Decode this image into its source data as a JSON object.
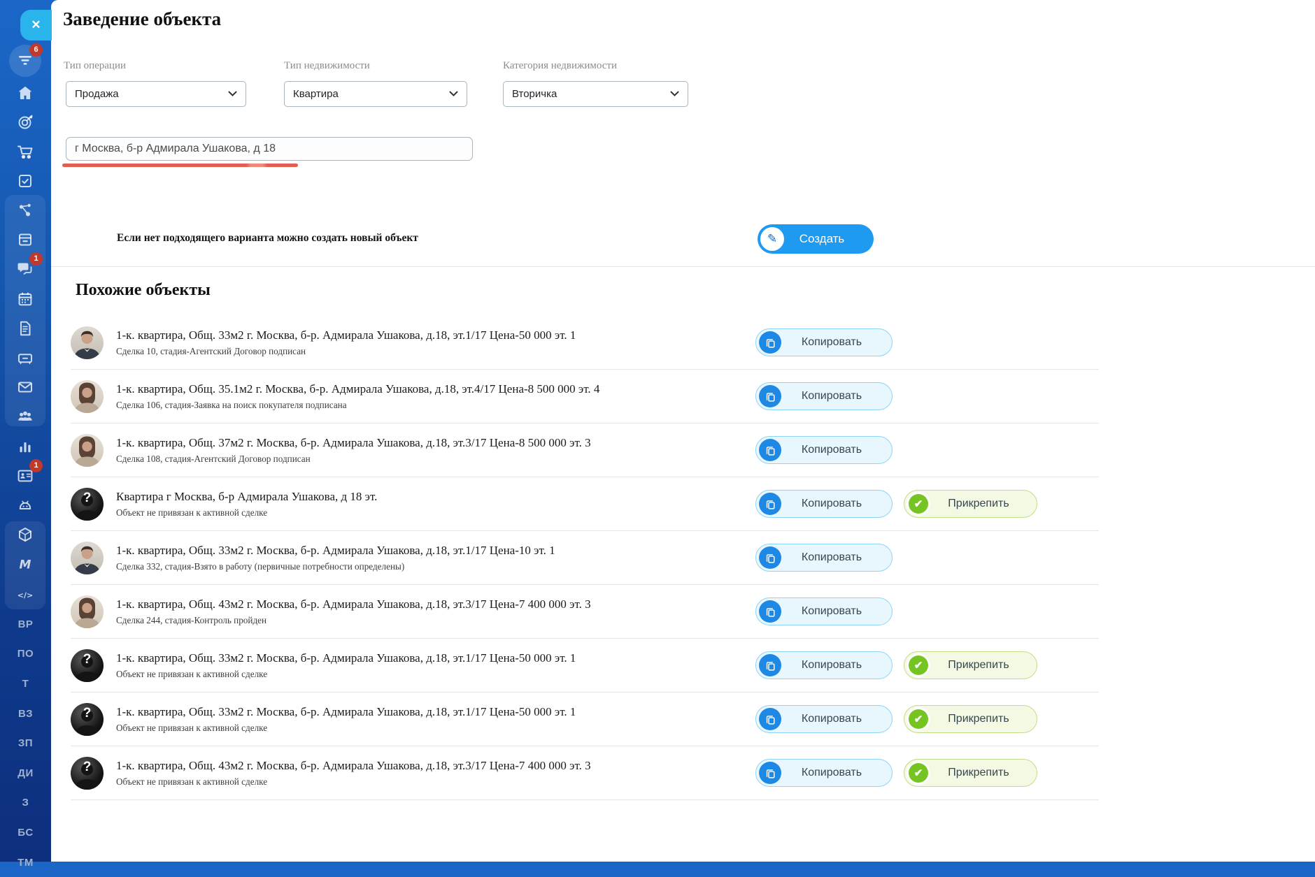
{
  "window": {
    "title": "Заведение объекта"
  },
  "sidebar": {
    "items": [
      {
        "icon": "filter-icon",
        "badge": "6"
      },
      {
        "icon": "home-icon"
      },
      {
        "icon": "target-icon"
      },
      {
        "icon": "cart-icon"
      },
      {
        "icon": "tasks-icon"
      },
      {
        "icon": "share-icon"
      },
      {
        "icon": "server-icon"
      },
      {
        "icon": "chat-icon",
        "badge": "1"
      },
      {
        "icon": "calendar-icon"
      },
      {
        "icon": "document-icon"
      },
      {
        "icon": "cash-drawer-icon"
      },
      {
        "icon": "mail-icon"
      },
      {
        "icon": "users-icon"
      },
      {
        "icon": "chart-icon"
      },
      {
        "icon": "contact-card-icon",
        "badge": "1"
      },
      {
        "icon": "robot-icon"
      },
      {
        "icon": "cube-icon"
      },
      {
        "icon": "logo-m-icon"
      },
      {
        "icon": "code-icon"
      }
    ],
    "text_items": [
      "ВР",
      "ПО",
      "Т",
      "ВЗ",
      "ЗП",
      "ДИ",
      "З",
      "БС",
      "ТМ"
    ]
  },
  "form": {
    "fields": [
      {
        "label": "Тип операции",
        "value": "Продажа"
      },
      {
        "label": "Тип недвижимости",
        "value": "Квартира"
      },
      {
        "label": "Категория недвижимости",
        "value": "Вторичка"
      }
    ],
    "address_value": "г Москва, б-р Адмирала Ушакова, д 18"
  },
  "create_section": {
    "hint": "Если нет подходящего варианта можно создать новый объект",
    "button_label": "Создать"
  },
  "similar": {
    "title": "Похожие объекты",
    "copy_label": "Копировать",
    "attach_label": "Прикрепить",
    "items": [
      {
        "avatar": "male-photo",
        "title": "1-к. квартира, Общ. 33м2 г. Москва, б-р. Адмирала Ушакова, д.18, эт.1/17 Цена-50 000 эт. 1",
        "subtitle": "Сделка 10, стадия-Агентский Договор подписан",
        "can_attach": false
      },
      {
        "avatar": "female-photo",
        "title": "1-к. квартира, Общ. 35.1м2 г. Москва, б-р. Адмирала Ушакова, д.18, эт.4/17 Цена-8 500 000 эт. 4",
        "subtitle": "Сделка 106, стадия-Заявка на поиск покупателя подписана",
        "can_attach": false
      },
      {
        "avatar": "female-photo",
        "title": "1-к. квартира, Общ. 37м2 г. Москва, б-р. Адмирала Ушакова, д.18, эт.3/17 Цена-8 500 000 эт. 3",
        "subtitle": "Сделка 108, стадия-Агентский Договор подписан",
        "can_attach": false
      },
      {
        "avatar": "anonymous",
        "title": "Квартира г Москва, б-р Адмирала Ушакова, д 18 эт.",
        "subtitle": "Объект не привязан к активной сделке",
        "can_attach": true
      },
      {
        "avatar": "male-photo",
        "title": "1-к. квартира, Общ. 33м2 г. Москва, б-р. Адмирала Ушакова, д.18, эт.1/17 Цена-10 эт. 1",
        "subtitle": "Сделка 332, стадия-Взято в работу (первичные потребности определены)",
        "can_attach": false
      },
      {
        "avatar": "female-photo",
        "title": "1-к. квартира, Общ. 43м2 г. Москва, б-р. Адмирала Ушакова, д.18, эт.3/17 Цена-7 400 000 эт. 3",
        "subtitle": "Сделка 244, стадия-Контроль пройден",
        "can_attach": false
      },
      {
        "avatar": "anonymous",
        "title": "1-к. квартира, Общ. 33м2 г. Москва, б-р. Адмирала Ушакова, д.18, эт.1/17 Цена-50 000 эт. 1",
        "subtitle": "Объект не привязан к активной сделке",
        "can_attach": true
      },
      {
        "avatar": "anonymous",
        "title": "1-к. квартира, Общ. 33м2 г. Москва, б-р. Адмирала Ушакова, д.18, эт.1/17 Цена-50 000 эт. 1",
        "subtitle": "Объект не привязан к активной сделке",
        "can_attach": true
      },
      {
        "avatar": "anonymous",
        "title": "1-к. квартира, Общ. 43м2 г. Москва, б-р. Адмирала Ушакова, д.18, эт.3/17 Цена-7 400 000 эт. 3",
        "subtitle": "Объект не привязан к активной сделке",
        "can_attach": true
      }
    ]
  },
  "colors": {
    "accent_blue": "#1e9bf0",
    "copy_icon_blue": "#1e88e5",
    "attach_green": "#76c421",
    "badge_red": "#c0392b",
    "underline_red": "#e35e50",
    "sidebar_top": "#1b67c7",
    "sidebar_bottom": "#0e2f7c"
  }
}
